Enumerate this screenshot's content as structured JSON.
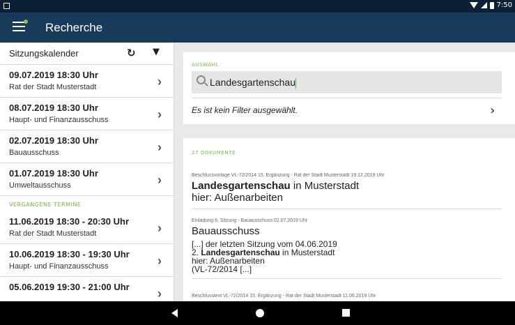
{
  "status": {
    "time": "7:50"
  },
  "appbar": {
    "title": "Recherche"
  },
  "sidebar": {
    "header": "Sitzungskalender",
    "upcoming": [
      {
        "date": "09.07.2019 18:30 Uhr",
        "org": "Rat der Stadt Musterstadt"
      },
      {
        "date": "08.07.2019 18:30 Uhr",
        "org": "Haupt- und Finanzausschuss"
      },
      {
        "date": "02.07.2019 18:30 Uhr",
        "org": "Bauausschuss"
      },
      {
        "date": "01.07.2019 18:30 Uhr",
        "org": "Umweltausschuss"
      }
    ],
    "past_label": "VERGANGENE TERMINE",
    "past": [
      {
        "date": "11.06.2019 18:30 - 20:30 Uhr",
        "org": "Rat der Stadt Musterstadt"
      },
      {
        "date": "10.06.2019 18:30 - 19:30 Uhr",
        "org": "Haupt- und Finanzausschuss"
      },
      {
        "date": "05.06.2019 19:30 - 21:00 Uhr",
        "org": ""
      }
    ]
  },
  "selection": {
    "label": "AUSWAHL",
    "search_value": "Landesgartenschau",
    "filter_text": "Es ist kein Filter ausgewählt."
  },
  "documents": {
    "count_label": "27 DOKUMENTE",
    "items": [
      {
        "meta": "Beschlussvorlage VL-72/2014 15. Ergänzung - Rat der Stadt Musterstadt 19.12.2019 Uhr",
        "title_bold": "Landesgartenschau",
        "title_rest": " in Musterstadt",
        "title_line2": "hier: Außenarbeiten"
      },
      {
        "meta": "Einladung 6. Sitzung - Bauausschuss 02.07.2019 Uhr",
        "title": "Bauausschuss",
        "line1": "[...]  der letzten Sitzung vom 04.06.2019",
        "line2_prefix": "2. ",
        "line2_bold": "Landesgartenschau",
        "line2_rest": " in Musterstadt",
        "line3": "hier: Außenarbeiten",
        "line4": "(VL-72/2014 [...]"
      },
      {
        "meta": "Beschlusstext VL-72/2014 15. Ergänzung - Rat der Stadt Musterstadt 11.06.2019 Uhr"
      }
    ]
  }
}
